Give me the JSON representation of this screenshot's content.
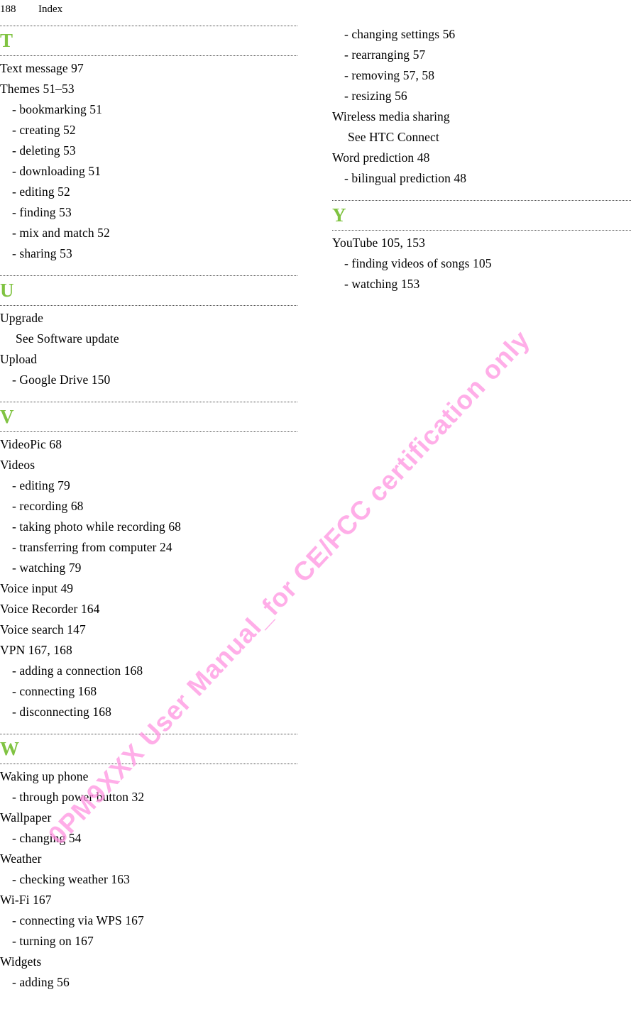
{
  "header": {
    "page_number": "188",
    "title": "Index"
  },
  "watermark": {
    "text": "0PM9XXX User Manual_for CE/FCC certification only",
    "color": "#ff8fe0"
  },
  "style": {
    "letter_color": "#80c342",
    "rule_color": "#4a4a4a"
  },
  "columns": [
    {
      "id": "left",
      "sections": [
        {
          "letter": "T",
          "entries": [
            {
              "level": 0,
              "text": "Text message  97"
            },
            {
              "level": 0,
              "text": "Themes  51–53"
            },
            {
              "level": 1,
              "text": "- bookmarking  51"
            },
            {
              "level": 1,
              "text": "- creating  52"
            },
            {
              "level": 1,
              "text": "- deleting  53"
            },
            {
              "level": 1,
              "text": "- downloading  51"
            },
            {
              "level": 1,
              "text": "- editing  52"
            },
            {
              "level": 1,
              "text": "- finding  53"
            },
            {
              "level": 1,
              "text": "- mix and match  52"
            },
            {
              "level": 1,
              "text": "- sharing  53"
            }
          ]
        },
        {
          "letter": "U",
          "entries": [
            {
              "level": 0,
              "text": "Upgrade"
            },
            {
              "level": 2,
              "text": "See Software update"
            },
            {
              "level": 0,
              "text": "Upload"
            },
            {
              "level": 1,
              "text": "- Google Drive  150"
            }
          ]
        },
        {
          "letter": "V",
          "entries": [
            {
              "level": 0,
              "text": "VideoPic  68"
            },
            {
              "level": 0,
              "text": "Videos"
            },
            {
              "level": 1,
              "text": "- editing  79"
            },
            {
              "level": 1,
              "text": "- recording  68"
            },
            {
              "level": 1,
              "text": "- taking photo while recording  68"
            },
            {
              "level": 1,
              "text": "- transferring from computer  24"
            },
            {
              "level": 1,
              "text": "- watching  79"
            },
            {
              "level": 0,
              "text": "Voice input  49"
            },
            {
              "level": 0,
              "text": "Voice Recorder  164"
            },
            {
              "level": 0,
              "text": "Voice search  147"
            },
            {
              "level": 0,
              "text": "VPN  167, 168"
            },
            {
              "level": 1,
              "text": "- adding a connection  168"
            },
            {
              "level": 1,
              "text": "- connecting  168"
            },
            {
              "level": 1,
              "text": "- disconnecting  168"
            }
          ]
        },
        {
          "letter": "W",
          "entries": [
            {
              "level": 0,
              "text": "Waking up phone"
            },
            {
              "level": 1,
              "text": "- through power button  32"
            },
            {
              "level": 0,
              "text": "Wallpaper"
            },
            {
              "level": 1,
              "text": "- changing  54"
            },
            {
              "level": 0,
              "text": "Weather"
            },
            {
              "level": 1,
              "text": "- checking weather  163"
            },
            {
              "level": 0,
              "text": "Wi-Fi  167"
            },
            {
              "level": 1,
              "text": "- connecting via WPS  167"
            },
            {
              "level": 1,
              "text": "- turning on  167"
            },
            {
              "level": 0,
              "text": "Widgets"
            },
            {
              "level": 1,
              "text": "- adding  56"
            }
          ]
        }
      ]
    },
    {
      "id": "right",
      "sections": [
        {
          "letter": "",
          "entries": [
            {
              "level": 1,
              "text": "- changing settings  56"
            },
            {
              "level": 1,
              "text": "- rearranging  57"
            },
            {
              "level": 1,
              "text": "- removing  57, 58"
            },
            {
              "level": 1,
              "text": "- resizing  56"
            },
            {
              "level": 0,
              "text": "Wireless media sharing"
            },
            {
              "level": 2,
              "text": "See HTC Connect"
            },
            {
              "level": 0,
              "text": "Word prediction  48"
            },
            {
              "level": 1,
              "text": "- bilingual prediction  48"
            }
          ]
        },
        {
          "letter": "Y",
          "entries": [
            {
              "level": 0,
              "text": "YouTube  105, 153"
            },
            {
              "level": 1,
              "text": "- finding videos of songs  105"
            },
            {
              "level": 1,
              "text": "- watching  153"
            }
          ]
        }
      ]
    }
  ]
}
